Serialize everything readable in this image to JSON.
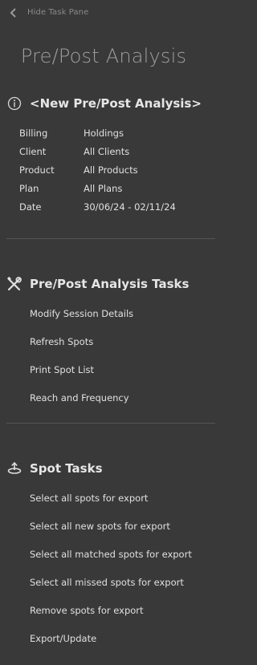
{
  "pane": {
    "hide_label": "Hide Task Pane",
    "title": "Pre/Post Analysis"
  },
  "analysis": {
    "title": "<New Pre/Post Analysis>",
    "fields": [
      {
        "label": "Billing",
        "value": "Holdings"
      },
      {
        "label": "Client",
        "value": "All Clients"
      },
      {
        "label": "Product",
        "value": "All Products"
      },
      {
        "label": "Plan",
        "value": "All Plans"
      },
      {
        "label": "Date",
        "value": "30/06/24 - 02/11/24"
      }
    ]
  },
  "analysis_tasks": {
    "title": "Pre/Post Analysis Tasks",
    "items": [
      "Modify Session Details",
      "Refresh Spots",
      "Print Spot List",
      "Reach and Frequency"
    ]
  },
  "spot_tasks": {
    "title": "Spot Tasks",
    "items": [
      "Select all spots for export",
      "Select all new spots for export",
      "Select all matched spots for export",
      "Select all missed spots for export",
      "Remove spots for export",
      "Export/Update"
    ]
  },
  "icons": {
    "hide": "chevron-left-icon",
    "info": "info-icon",
    "tools": "tools-icon",
    "spot": "spot-upload-icon"
  },
  "colors": {
    "background": "#393939",
    "text": "#e0e0e0",
    "muted": "#8a8a8a",
    "title_muted": "#9e9e9e",
    "divider": "#555555"
  }
}
